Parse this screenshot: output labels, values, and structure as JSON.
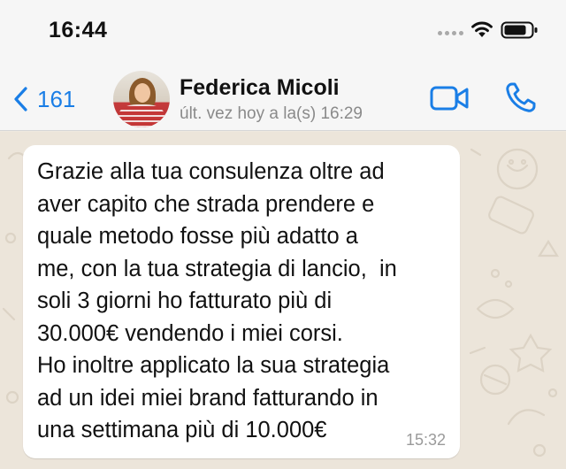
{
  "status_bar": {
    "time": "16:44",
    "signal_icon": "signal-dots-icon",
    "wifi_icon": "wifi-icon",
    "battery_icon": "battery-icon"
  },
  "nav": {
    "back_count": "161",
    "contact_name": "Federica Micoli",
    "last_seen": "últ. vez hoy a la(s) 16:29",
    "accent_color": "#1a7ee6"
  },
  "chat": {
    "messages": [
      {
        "text": "Grazie alla tua consulenza oltre ad\naver capito che strada prendere e\nquale metodo fosse più adatto a\nme, con la tua strategia di lancio,  in\nsoli 3 giorni ho fatturato più di\n30.000€ vendendo i miei corsi.\nHo inoltre applicato la sua strategia\nad un idei miei brand fatturando in\nuna settimana più di 10.000€",
        "time": "15:32"
      }
    ]
  }
}
